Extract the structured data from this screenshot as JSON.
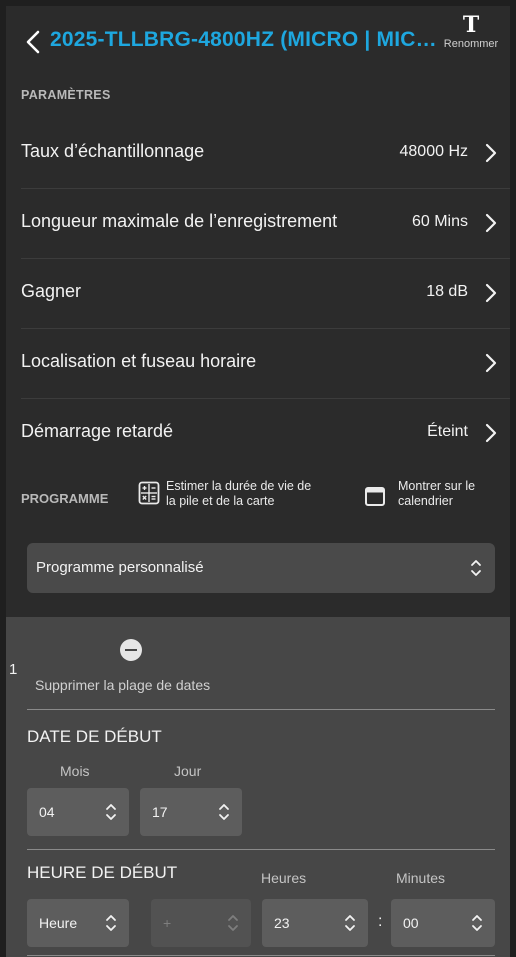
{
  "header": {
    "title": "2025-TLLBRG-4800HZ (MICRO | MICR..",
    "rename_glyph": "T",
    "rename_label": "Renommer"
  },
  "parameters": {
    "heading": "PARAMÈTRES",
    "rows": [
      {
        "label": "Taux d’échantillonnage",
        "value": "48000 Hz"
      },
      {
        "label": "Longueur maximale de l’enregistrement",
        "value": "60 Mins"
      },
      {
        "label": "Gagner",
        "value": "18 dB"
      },
      {
        "label": "Localisation et fuseau horaire",
        "value": ""
      },
      {
        "label": "Démarrage retardé",
        "value": "Éteint"
      }
    ]
  },
  "program": {
    "heading": "PROGRAMME",
    "estimate_line1": "Estimer la durée de vie de",
    "estimate_line2": "la pile et de la carte",
    "calendar_line1": "Montrer sur le",
    "calendar_line2": "calendrier",
    "selected": "Programme personnalisé"
  },
  "schedule": {
    "index": "1",
    "delete_label": "Supprimer la plage de dates",
    "start_date": {
      "title": "DATE DE DÉBUT",
      "month_label": "Mois",
      "day_label": "Jour",
      "month": "04",
      "day": "17"
    },
    "start_time": {
      "title": "HEURE DE DÉBUT",
      "mode": "Heure",
      "offset_sign": "+",
      "hours_label": "Heures",
      "minutes_label": "Minutes",
      "hours": "23",
      "minutes": "00",
      "separator": ":"
    }
  },
  "icons": {
    "back": "chevron-left-icon",
    "chevron": "chevron-right-icon",
    "calculator": "calculator-icon",
    "calendar": "calendar-icon",
    "updown": "chevron-up-down-icon",
    "remove": "minus-circle-icon"
  },
  "colors": {
    "accent": "#1ea7df",
    "background": "#2b2b2b",
    "panel": "#474747"
  }
}
